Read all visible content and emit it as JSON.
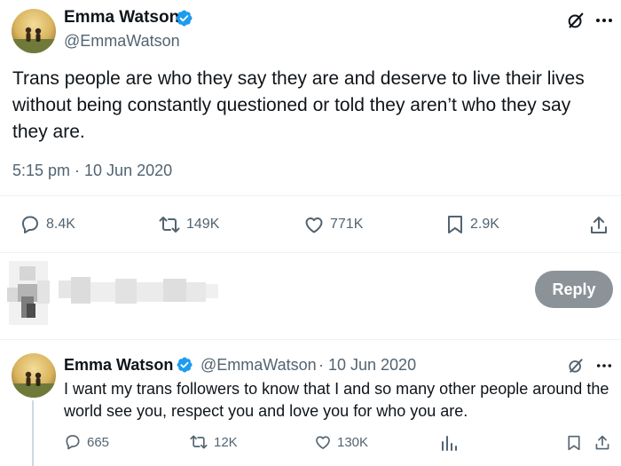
{
  "main_tweet": {
    "author_name": "Emma Watson",
    "author_handle": "@EmmaWatson",
    "text": "Trans people are who they say they are and deserve to live their lives without being constantly questioned or told they aren’t who they say they are.",
    "timestamp": "5:15 pm · 10 Jun 2020",
    "stats": {
      "replies": "8.4K",
      "retweets": "149K",
      "likes": "771K",
      "bookmarks": "2.9K"
    }
  },
  "composer": {
    "reply_label": "Reply"
  },
  "reply_tweet": {
    "author_name": "Emma Watson",
    "author_handle": "@EmmaWatson",
    "date": "· 10 Jun 2020",
    "text": "I want my trans followers to know that I and so many other people around the world see you, respect you and love you for who you are.",
    "stats": {
      "replies": "665",
      "retweets": "12K",
      "likes": "130K"
    }
  },
  "colors": {
    "verified": "#1d9bf0",
    "muted": "#536471",
    "reply_button": "#8b9298"
  },
  "icons": [
    "verified-badge-icon",
    "grok-icon",
    "more-icon",
    "reply-icon",
    "retweet-icon",
    "like-icon",
    "bookmark-icon",
    "share-icon",
    "views-icon"
  ]
}
